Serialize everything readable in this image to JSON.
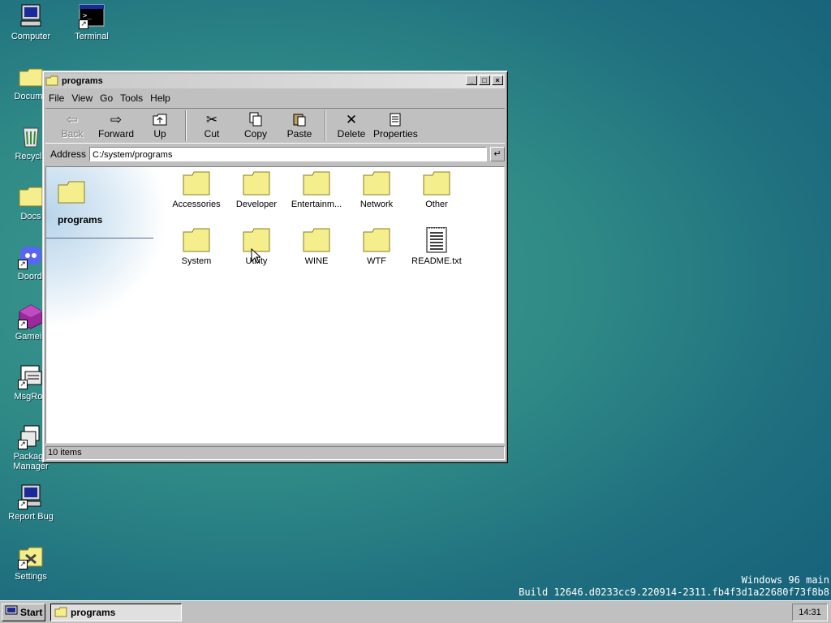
{
  "desktop": {
    "icons": [
      {
        "label": "Computer",
        "icon": "computer-icon"
      },
      {
        "label": "Terminal",
        "icon": "terminal-icon"
      },
      {
        "label": "Docume",
        "icon": "documents-folder-icon"
      },
      {
        "label": "Recycle",
        "icon": "recycle-bin-icon"
      },
      {
        "label": "Docs",
        "icon": "folder-icon"
      },
      {
        "label": "Doordi",
        "icon": "doordisc-icon"
      },
      {
        "label": "Gamein",
        "icon": "game-icon"
      },
      {
        "label": "MsgRoo",
        "icon": "msgroom-icon"
      },
      {
        "label": "Package Manager",
        "icon": "package-manager-icon"
      },
      {
        "label": "Report Bug",
        "icon": "report-bug-icon"
      },
      {
        "label": "Settings",
        "icon": "settings-icon"
      }
    ]
  },
  "window": {
    "title": "programs",
    "menu": [
      "File",
      "View",
      "Go",
      "Tools",
      "Help"
    ],
    "toolbar": {
      "back": "Back",
      "forward": "Forward",
      "up": "Up",
      "cut": "Cut",
      "copy": "Copy",
      "paste": "Paste",
      "delete": "Delete",
      "properties": "Properties"
    },
    "address": {
      "label": "Address",
      "value": "C:/system/programs"
    },
    "side_panel_title": "programs",
    "files": [
      {
        "name": "Accessories",
        "type": "folder"
      },
      {
        "name": "Developer",
        "type": "folder"
      },
      {
        "name": "Entertainm...",
        "type": "folder"
      },
      {
        "name": "Network",
        "type": "folder"
      },
      {
        "name": "Other",
        "type": "folder"
      },
      {
        "name": "System",
        "type": "folder"
      },
      {
        "name": "Utility",
        "type": "folder"
      },
      {
        "name": "WINE",
        "type": "folder"
      },
      {
        "name": "WTF",
        "type": "folder"
      },
      {
        "name": "README.txt",
        "type": "text-file"
      }
    ],
    "status": "10 items"
  },
  "build_info": {
    "line1": "Windows 96 main",
    "line2": "Build 12646.d0233cc9.220914-2311.fb4f3d1a22680f73f8b8"
  },
  "taskbar": {
    "start_label": "Start",
    "task_label": "programs",
    "clock": "14:31"
  },
  "colors": {
    "folder_yellow": "#f5ee8c",
    "desktop_teal": "#2f8a86",
    "chrome_gray": "#c0c0c0"
  }
}
